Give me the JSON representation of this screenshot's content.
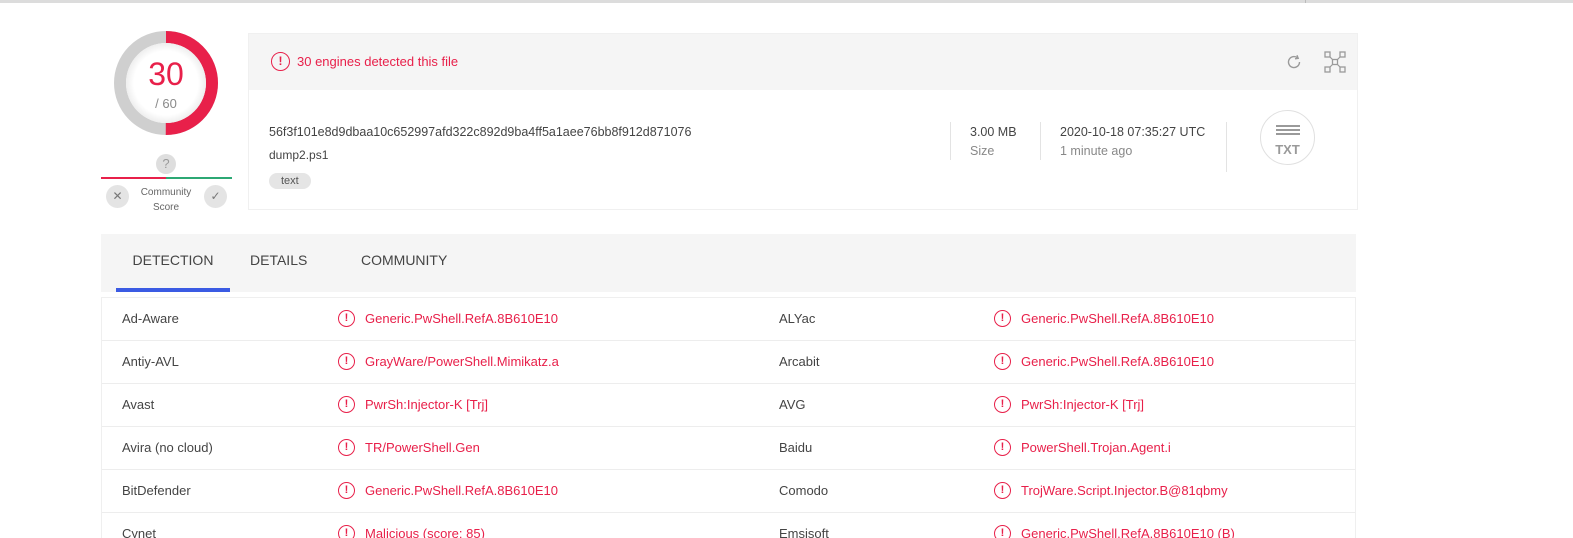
{
  "score": {
    "detected": "30",
    "total": "/ 60",
    "detected_fraction": 0.5,
    "accent_color": "#e8204a"
  },
  "community": {
    "question_mark": "?",
    "label_line1": "Community",
    "label_line2": "Score",
    "downvote_icon": "close-icon",
    "upvote_icon": "check-icon"
  },
  "header": {
    "alert_icon": "!",
    "alert_text": "30 engines detected this file",
    "hash": "56f3f101e8d9dbaa10c652997afd322c892d9ba4ff5a1aee76bb8f912d871076",
    "filename": "dump2.ps1",
    "tag": "text",
    "size_value": "3.00 MB",
    "size_label": "Size",
    "date_value": "2020-10-18 07:35:27 UTC",
    "date_ago": "1 minute ago",
    "filetype": "TXT"
  },
  "tabs": [
    {
      "label": "DETECTION",
      "active": true
    },
    {
      "label": "DETAILS",
      "active": false
    },
    {
      "label": "COMMUNITY",
      "active": false
    }
  ],
  "detections": [
    {
      "engine1": "Ad-Aware",
      "result1": "Generic.PwShell.RefA.8B610E10",
      "engine2": "ALYac",
      "result2": "Generic.PwShell.RefA.8B610E10"
    },
    {
      "engine1": "Antiy-AVL",
      "result1": "GrayWare/PowerShell.Mimikatz.a",
      "engine2": "Arcabit",
      "result2": "Generic.PwShell.RefA.8B610E10"
    },
    {
      "engine1": "Avast",
      "result1": "PwrSh:Injector-K [Trj]",
      "engine2": "AVG",
      "result2": "PwrSh:Injector-K [Trj]"
    },
    {
      "engine1": "Avira (no cloud)",
      "result1": "TR/PowerShell.Gen",
      "engine2": "Baidu",
      "result2": "PowerShell.Trojan.Agent.i"
    },
    {
      "engine1": "BitDefender",
      "result1": "Generic.PwShell.RefA.8B610E10",
      "engine2": "Comodo",
      "result2": "TrojWare.Script.Injector.B@81qbmy"
    },
    {
      "engine1": "Cynet",
      "result1": "Malicious (score: 85)",
      "engine2": "Emsisoft",
      "result2": "Generic.PwShell.RefA.8B610E10 (B)"
    }
  ]
}
